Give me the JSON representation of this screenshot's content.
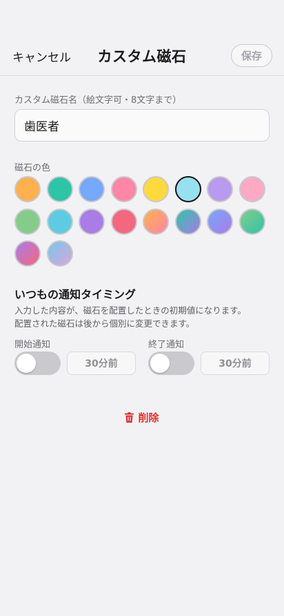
{
  "header": {
    "cancel_label": "キャンセル",
    "title": "カスタム磁石",
    "save_label": "保存"
  },
  "name_field": {
    "label": "カスタム磁石名（絵文字可・8文字まで）",
    "value": "歯医者"
  },
  "color_section": {
    "label": "磁石の色",
    "selected_index": 5,
    "swatches": [
      {
        "fill": "#ffb14f"
      },
      {
        "fill": "#2ec4a8"
      },
      {
        "fill": "#76a8fb"
      },
      {
        "fill": "#ff86a6"
      },
      {
        "fill": "#ffd93e"
      },
      {
        "fill": "#97e0f0"
      },
      {
        "fill": "#b89aee"
      },
      {
        "fill": "#ffa9c4"
      },
      {
        "fill": "#85cc8a"
      },
      {
        "fill": "#5fcbe3"
      },
      {
        "fill": "#aa7ce6"
      },
      {
        "fill": "#f3687f"
      },
      {
        "gradient": [
          "#ffb14f",
          "#ff86a6"
        ]
      },
      {
        "gradient": [
          "#2ec4a8",
          "#aa7ce6"
        ]
      },
      {
        "gradient": [
          "#76a8fb",
          "#aa7ce6"
        ]
      },
      {
        "gradient": [
          "#85cc8a",
          "#2ec4a8"
        ]
      },
      {
        "gradient": [
          "#aa7ce6",
          "#f3687f"
        ]
      },
      {
        "gradient": [
          "#76c8e8",
          "#d9a6dc"
        ]
      }
    ]
  },
  "timing": {
    "title": "いつもの通知タイミング",
    "description_line1": "入力した内容が、磁石を配置したときの初期値になります。",
    "description_line2": "配置された磁石は後から個別に変更できます。",
    "start": {
      "label": "開始通知",
      "time": "30分前",
      "enabled": false
    },
    "end": {
      "label": "終了通知",
      "time": "30分前",
      "enabled": false
    }
  },
  "delete_label": "削除",
  "colors": {
    "accent_red": "#e03131"
  }
}
